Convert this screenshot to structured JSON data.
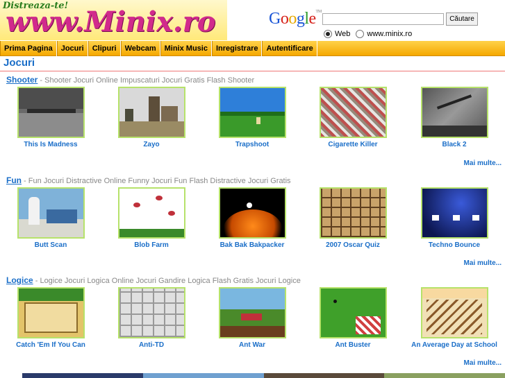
{
  "header": {
    "logo_tagline": "Distreaza-te!",
    "logo_text": "www.Minix.ro",
    "search": {
      "google_logo": "Google",
      "input_value": "",
      "button_label": "Căutare",
      "radio_options": [
        {
          "label": "Web",
          "selected": true
        },
        {
          "label": "www.minix.ro",
          "selected": false
        }
      ]
    }
  },
  "nav": {
    "items": [
      "Prima Pagina",
      "Jocuri",
      "Clipuri",
      "Webcam",
      "Minix Music",
      "Inregistrare",
      "Autentificare"
    ]
  },
  "page_title": "Jocuri",
  "more_label": "Mai multe...",
  "sections": [
    {
      "name": "Shooter",
      "description": " - Shooter Jocuri Online Impuscaturi Jocuri Gratis Flash Shooter",
      "games": [
        "This Is Madness",
        "Zayo",
        "Trapshoot",
        "Cigarette Killer",
        "Black 2"
      ]
    },
    {
      "name": "Fun",
      "description": " - Fun Jocuri Distractive Online Funny Jocuri Fun Flash Distractive Jocuri Gratis",
      "games": [
        "Butt Scan",
        "Blob Farm",
        "Bak Bak Bakpacker",
        "2007 Oscar Quiz",
        "Techno Bounce"
      ]
    },
    {
      "name": "Logice",
      "description": " - Logice Jocuri Logica Online Jocuri Gandire Logica Flash Gratis Jocuri Logice",
      "games": [
        "Catch 'Em If You Can",
        "Anti-TD",
        "Ant War",
        "Ant Buster",
        "An Average Day at School"
      ]
    }
  ],
  "colors": {
    "nav_bg": "#f5a800",
    "link_blue": "#1a6ec8",
    "thumb_border": "#b6e26a",
    "logo_pink": "#d12a8c"
  }
}
